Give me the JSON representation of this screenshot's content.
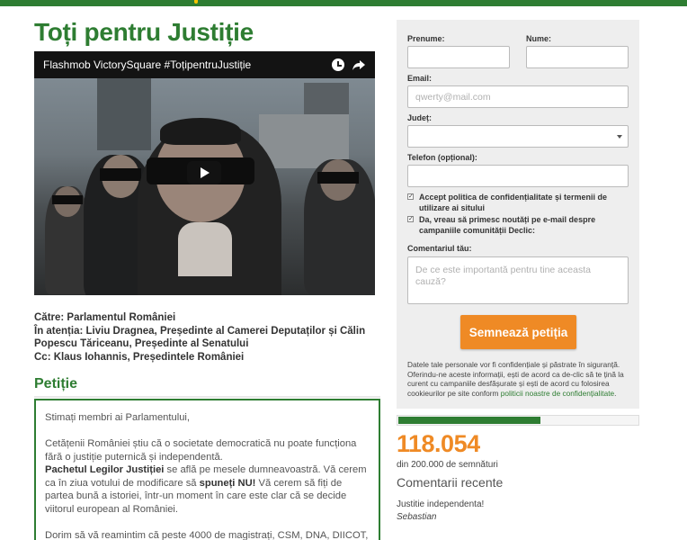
{
  "page": {
    "title": "Toți pentru Justiție"
  },
  "video": {
    "title": "Flashmob VictorySquare #ToțipentruJustiție"
  },
  "addressee": {
    "to": "Către: Parlamentul României",
    "attention": "În atenția: Liviu Dragnea, Președinte al Camerei Deputaților și Călin Popescu Tăriceanu, Președinte al Senatului",
    "cc": "Cc: Klaus Iohannis, Președintele României"
  },
  "petition": {
    "heading": "Petiție",
    "greeting": "Stimați membri ai Parlamentului,",
    "p1": "Cetățenii României știu că o societate democratică nu poate funcționa fără o justiție puternică și independentă.",
    "p2_bold": "Pachetul Legilor Justiției",
    "p2_mid": " se află pe mesele dumneavoastră. Vă cerem ca în ziua votului de modificare să ",
    "p2_bold2": "spuneți NU!",
    "p2_end": " Vă cerem să fiți de partea bună a istoriei, într-un moment în care este clar că se decide viitorul european al României.",
    "p3": "Dorim să vă reamintim că peste 4000 de magistrați, CSM, DNA, DIICOT,"
  },
  "form": {
    "first_name_label": "Prenume:",
    "last_name_label": "Nume:",
    "email_label": "Email:",
    "email_placeholder": "qwerty@mail.com",
    "county_label": "Județ:",
    "phone_label": "Telefon (opțional):",
    "consent_label": "Accept politica de confidențialitate și termenii de utilizare ai sitului",
    "newsletter_label": "Da, vreau să primesc noutăți pe e-mail despre campaniile comunității Declic:",
    "comment_label": "Comentariul tău:",
    "comment_placeholder": "De ce este importantă pentru tine aceasta cauză?",
    "submit_label": "Semnează petiția",
    "privacy_text": "Datele tale personale vor fi confidențiale și păstrate în siguranță. Oferindu-ne aceste informații, ești de acord ca de-clic să te țină la curent cu campaniile desfășurate și ești de acord cu folosirea cookieurilor pe site conform ",
    "privacy_link": "politicii noastre de confidențialitate",
    "privacy_end": "."
  },
  "stats": {
    "progress_fraction": 0.59,
    "count": "118.054",
    "goal": "din 200.000 de semnături",
    "recent_title": "Comentarii recente"
  },
  "recent_comment": {
    "text": "Justitie independenta!",
    "author": "Sebastian"
  },
  "colors": {
    "brand_green": "#2e7d32",
    "accent_orange": "#ef8a25"
  },
  "icons": [
    "clock-icon",
    "share-icon",
    "play-icon",
    "chevron-down-icon"
  ]
}
